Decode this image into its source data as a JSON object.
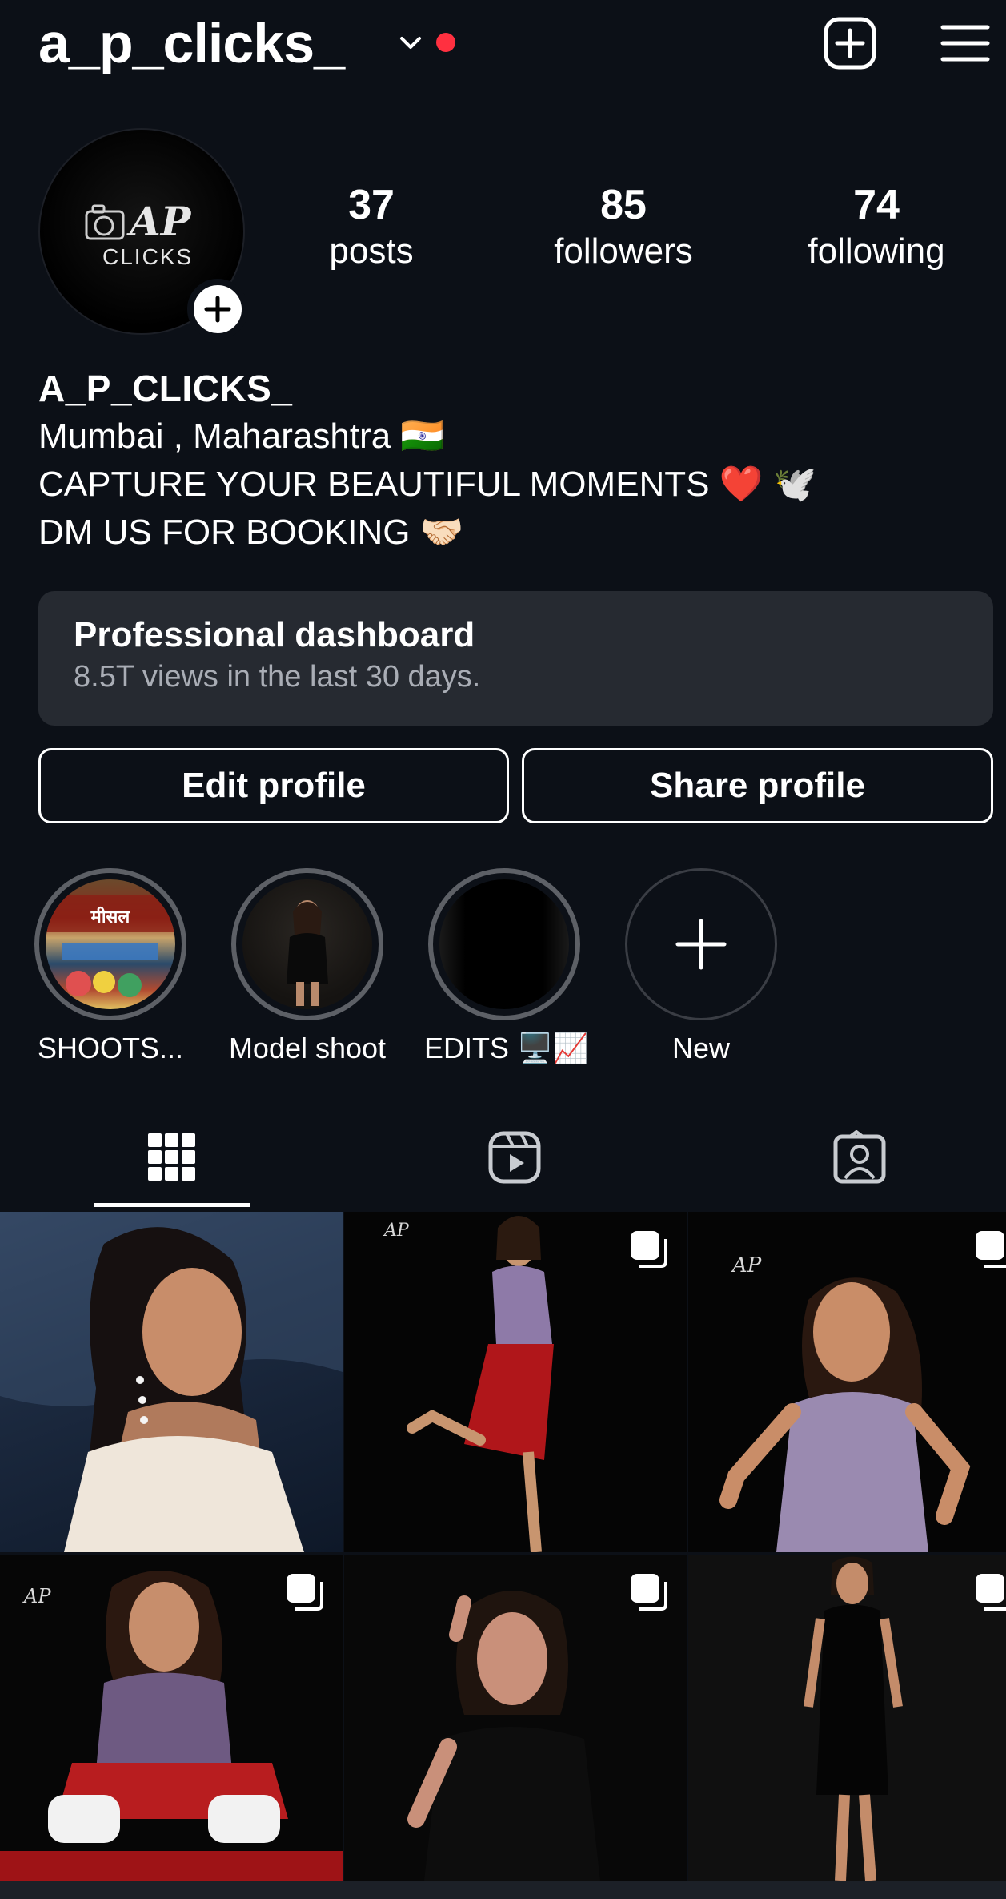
{
  "header": {
    "username": "a_p_clicks_",
    "new_post_icon": "plus-square-icon",
    "menu_icon": "hamburger-menu-icon",
    "notification_dot_color": "#ff3040"
  },
  "profile": {
    "avatar_logo_text": "AP CLICKS",
    "stats": {
      "posts": {
        "value": "37",
        "label": "posts"
      },
      "followers": {
        "value": "85",
        "label": "followers"
      },
      "following": {
        "value": "74",
        "label": "following"
      }
    },
    "bio": {
      "name": "A_P_CLICKS_",
      "lines": [
        "Mumbai , Maharashtra 🇮🇳",
        "CAPTURE YOUR BEAUTIFUL MOMENTS ❤️ 🕊️",
        "DM US FOR BOOKING 🤝🏻"
      ]
    }
  },
  "dashboard": {
    "title": "Professional dashboard",
    "subtitle": "8.5T views in the last 30 days."
  },
  "buttons": {
    "edit": "Edit profile",
    "share": "Share profile"
  },
  "highlights": [
    {
      "label": "SHOOTS..."
    },
    {
      "label": "Model shoot"
    },
    {
      "label": "EDITS 🖥️📈"
    },
    {
      "label": "New"
    }
  ],
  "tabs": [
    {
      "icon": "grid-icon",
      "active": true
    },
    {
      "icon": "reels-icon",
      "active": false
    },
    {
      "icon": "tagged-icon",
      "active": false
    }
  ],
  "posts": [
    {
      "multi": false,
      "watermark": false
    },
    {
      "multi": true,
      "watermark": true
    },
    {
      "multi": true,
      "watermark": true
    },
    {
      "multi": true,
      "watermark": true
    },
    {
      "multi": true,
      "watermark": false
    },
    {
      "multi": true,
      "watermark": false
    }
  ],
  "colors": {
    "background": "#0c1017",
    "card": "#262a31",
    "muted_text": "#a9adb5",
    "ring": "#5d6066"
  }
}
